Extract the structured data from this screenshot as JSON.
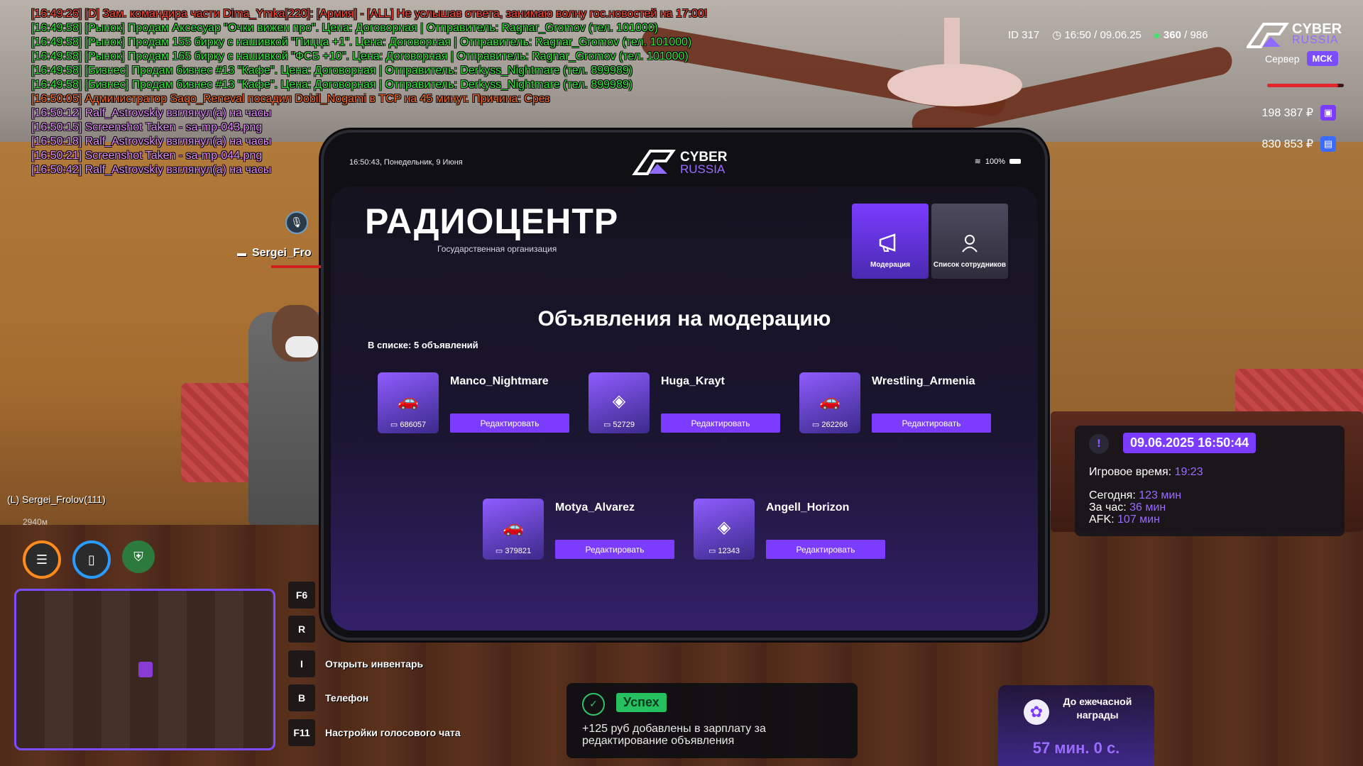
{
  "chat": [
    {
      "text": "[16:49:26] [D] Зам. командира части Dima_Ymka[220]: [Армия] - [ALL] Не услышав ответа, занимаю волну гос.новостей на 17:00!",
      "color": "#ff4a3a"
    },
    {
      "text": "[16:49:58] [Рынок] Продам Аксесуар \"Очки вижен про\". Цена: Договорная | Отправитель: Ragnar_Gromov (тел. 101000)",
      "color": "#35e83c"
    },
    {
      "text": "[16:49:58] [Рынок] Продам 155 бирку с нашивкой \"Пицца +1\". Цена: Договорная | Отправитель: Ragnar_Gromov (тел. 101000)",
      "color": "#35e83c"
    },
    {
      "text": "[16:49:58] [Рынок] Продам 165 бирку с нашивкой \"ФСБ +10\". Цена: Договорная | Отправитель: Ragnar_Gromov (тел. 101000)",
      "color": "#35e83c"
    },
    {
      "text": "[16:49:58] [Бизнес] Продам бизнес #13 \"Кафе\". Цена: Договорная | Отправитель: Derkyss_Nightmare (тел. 899989)",
      "color": "#35e83c"
    },
    {
      "text": "[16:49:58] [Бизнес] Продам бизнес #13 \"Кафе\". Цена: Договорная | Отправитель: Derkyss_Nightmare (тел. 899989)",
      "color": "#35e83c"
    },
    {
      "text": "[16:50:05] Администратор Saqo_Reneval посадил Dobil_Nogami в TCP на 45 минут. Причина: Срез",
      "color": "#ff6d2a"
    },
    {
      "text": "[16:50:12] Ralf_Astrovskiy взглянул(а) на часы",
      "color": "#e58cff"
    },
    {
      "text": "[16:50:15] Screenshot Taken - sa-mp-043.png",
      "color": "#e58cff"
    },
    {
      "text": "[16:50:18] Ralf_Astrovskiy взглянул(а) на часы",
      "color": "#e58cff"
    },
    {
      "text": "[16:50:21] Screenshot Taken - sa-mp-044.png",
      "color": "#e58cff"
    },
    {
      "text": "[16:50:42] Ralf_Astrovskiy взглянул(а) на часы",
      "color": "#e58cff"
    }
  ],
  "hud": {
    "id": "ID 317",
    "clock": "16:50 / 09.06.25",
    "online": "360",
    "online_max": "/ 986",
    "logo_word1": "CYBER",
    "logo_word2": "RUSSIA",
    "server_label": "Сервер",
    "server_name": "МСК",
    "health_fraction": 0.93,
    "money1": "198 387 ₽",
    "money2": "830 853 ₽"
  },
  "tablet": {
    "status_time": "16:50:43, Понедельник, 9 Июня",
    "battery": "100%",
    "logo_word1": "CYBER",
    "logo_word2": "RUSSIA",
    "org_title": "РАДИОЦЕНТР",
    "org_subtitle": "Государственная организация",
    "tiles": {
      "moderation": "Модерация",
      "employees": "Список сотрудников"
    },
    "section_title": "Объявления на модерацию",
    "count_label": "В списке: 5 объявлений",
    "edit_label": "Редактировать",
    "ads": [
      {
        "name": "Manco_Nightmare",
        "number": "686057",
        "icon": "car-icon"
      },
      {
        "name": "Huga_Krayt",
        "number": "52729",
        "icon": "diamond-icon"
      },
      {
        "name": "Wrestling_Armenia",
        "number": "262266",
        "icon": "car-icon"
      },
      {
        "name": "Motya_Alvarez",
        "number": "379821",
        "icon": "car-icon"
      },
      {
        "name": "Angell_Horizon",
        "number": "12343",
        "icon": "diamond-icon"
      }
    ]
  },
  "player": {
    "nametag": "Sergei_Fro",
    "label": "(L) Sergei_Frolov(111)",
    "distance": "2940м"
  },
  "hints": [
    {
      "key": "F6",
      "label": ""
    },
    {
      "key": "R",
      "label": ""
    },
    {
      "key": "I",
      "label": "Открыть инвентарь"
    },
    {
      "key": "B",
      "label": "Телефон"
    },
    {
      "key": "F11",
      "label": "Настройки голосового чата"
    }
  ],
  "notification": {
    "badge": "Успех",
    "text": "+125 руб добавлены в зарплату за редактирование объявления"
  },
  "info": {
    "datetime": "09.06.2025 16:50:44",
    "game_time_label": "Игровое время:",
    "game_time": "19:23",
    "today_label": "Сегодня:",
    "today": "123 мин",
    "hour_label": "За час:",
    "hour": "36 мин",
    "afk_label": "AFK:",
    "afk": "107 мин"
  },
  "reward": {
    "text": "До ежечасной награды",
    "timer": "57 мин. 0 с."
  }
}
